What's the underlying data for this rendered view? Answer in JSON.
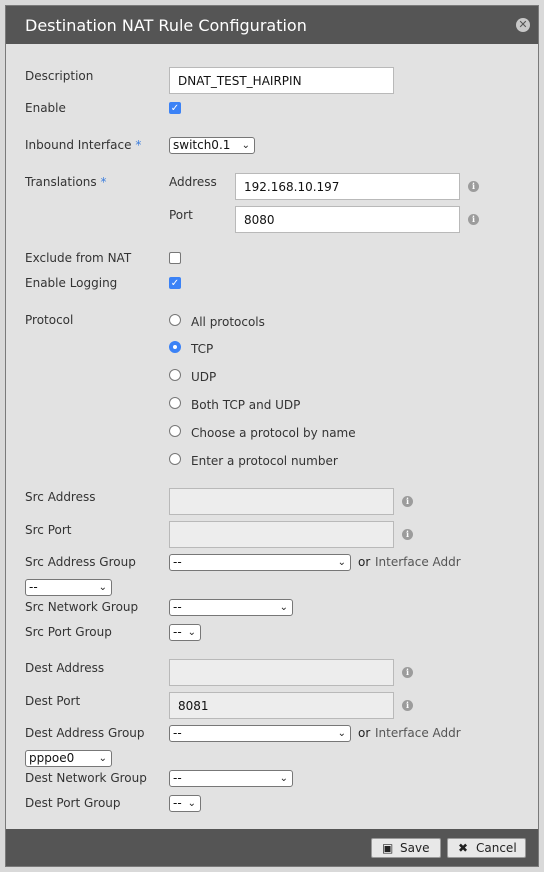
{
  "dialog": {
    "title": "Destination NAT Rule Configuration"
  },
  "fields": {
    "description": {
      "label": "Description",
      "value": "DNAT_TEST_HAIRPIN"
    },
    "enable": {
      "label": "Enable",
      "checked": true
    },
    "inbound_interface": {
      "label": "Inbound Interface",
      "required": "*",
      "value": "switch0.1"
    },
    "translations": {
      "label": "Translations",
      "required": "*",
      "address_label": "Address",
      "address_value": "192.168.10.197",
      "port_label": "Port",
      "port_value": "8080"
    },
    "exclude_from_nat": {
      "label": "Exclude from NAT",
      "checked": false
    },
    "enable_logging": {
      "label": "Enable Logging",
      "checked": true
    },
    "protocol": {
      "label": "Protocol",
      "options": [
        "All protocols",
        "TCP",
        "UDP",
        "Both TCP and UDP",
        "Choose a protocol by name",
        "Enter a protocol number"
      ],
      "selected": "TCP"
    },
    "src_address": {
      "label": "Src Address",
      "value": ""
    },
    "src_port": {
      "label": "Src Port",
      "value": ""
    },
    "src_address_group": {
      "label": "Src Address Group",
      "value": "--",
      "or_text": "or",
      "interface_addr_label": "Interface Addr",
      "interface_addr_value": "--"
    },
    "src_network_group": {
      "label": "Src Network Group",
      "value": "--"
    },
    "src_port_group": {
      "label": "Src Port Group",
      "value": "--"
    },
    "dest_address": {
      "label": "Dest Address",
      "value": ""
    },
    "dest_port": {
      "label": "Dest Port",
      "value": "8081"
    },
    "dest_address_group": {
      "label": "Dest Address Group",
      "value": "--",
      "or_text": "or",
      "interface_addr_label": "Interface Addr",
      "interface_addr_value": "pppoe0"
    },
    "dest_network_group": {
      "label": "Dest Network Group",
      "value": "--"
    },
    "dest_port_group": {
      "label": "Dest Port Group",
      "value": "--"
    }
  },
  "footer": {
    "save_label": "Save",
    "cancel_label": "Cancel"
  },
  "icons": {
    "close": "close-icon",
    "info": "info-icon",
    "save": "save-disk-icon",
    "cancel": "x-icon"
  },
  "colors": {
    "titlebar": "#555555",
    "accent": "#3b82f6",
    "required": "#3b7ddd"
  }
}
